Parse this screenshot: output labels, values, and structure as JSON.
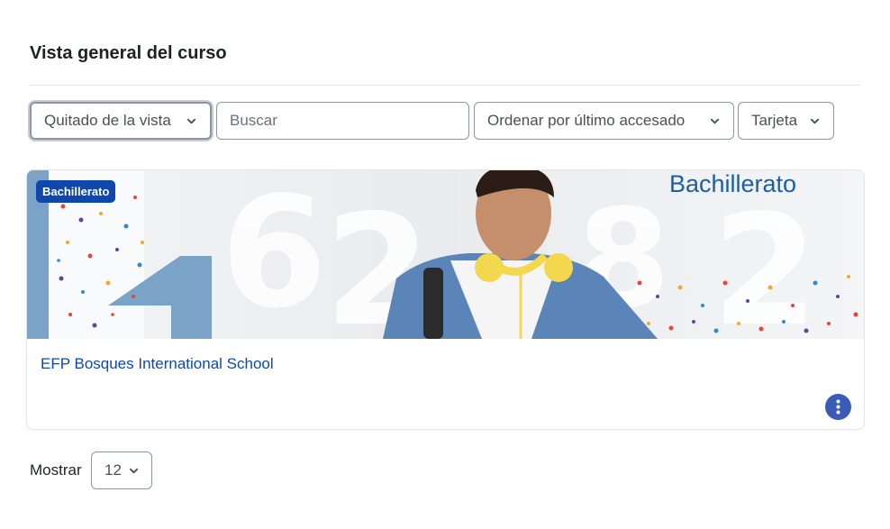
{
  "block": {
    "title": "Vista general del curso"
  },
  "filters": {
    "grouping": {
      "selected": "Quitado de la vista"
    },
    "search": {
      "placeholder": "Buscar",
      "value": ""
    },
    "sort": {
      "selected": "Ordenar por último accesado"
    },
    "view": {
      "selected": "Tarjeta"
    }
  },
  "courses": [
    {
      "category_badge": "Bachillerato",
      "image_heading": "Bachillerato",
      "name": "EFP Bosques International School",
      "actions_icon": "kebab-vertical-icon"
    }
  ],
  "paging": {
    "label": "Mostrar",
    "per_page": "12"
  },
  "colors": {
    "link": "#0f47ad",
    "badge_bg": "#0f47ad",
    "actions_bg": "#3a5bb7",
    "border": "#8f959e",
    "banner_accent": "#7ba3c8"
  }
}
